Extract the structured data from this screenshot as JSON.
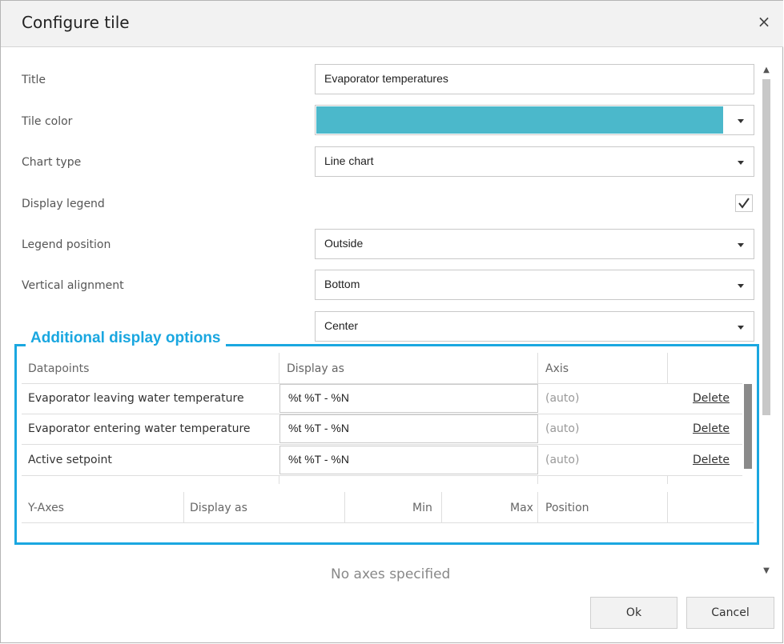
{
  "dialog": {
    "title": "Configure tile",
    "close_label": "×"
  },
  "form": {
    "title_label": "Title",
    "title_value": "Evaporator temperatures",
    "tile_color_label": "Tile color",
    "tile_color": "#4bb8cb",
    "chart_type_label": "Chart type",
    "chart_type_value": "Line chart",
    "display_legend_label": "Display legend",
    "display_legend_checked": true,
    "legend_position_label": "Legend position",
    "legend_position_value": "Outside",
    "vertical_alignment_label": "Vertical alignment",
    "vertical_alignment_value": "Bottom",
    "horizontal_alignment_value": "Center"
  },
  "annotation": {
    "title": "Additional display options",
    "color": "#1aa7e0"
  },
  "datapoints": {
    "headers": [
      "Datapoints",
      "Display as",
      "Axis"
    ],
    "rows": [
      {
        "name": "Evaporator leaving water temperature",
        "display_as": "%t %T - %N",
        "axis": "(auto)",
        "action": "Delete"
      },
      {
        "name": "Evaporator entering water temperature",
        "display_as": "%t %T - %N",
        "axis": "(auto)",
        "action": "Delete"
      },
      {
        "name": "Active setpoint",
        "display_as": "%t %T - %N",
        "axis": "(auto)",
        "action": "Delete"
      }
    ]
  },
  "yaxes": {
    "headers": [
      "Y-Axes",
      "Display as",
      "Min",
      "Max",
      "Position"
    ],
    "empty_text": "No axes specified"
  },
  "buttons": {
    "ok": "Ok",
    "cancel": "Cancel"
  },
  "icons": {
    "close": "close-icon",
    "check": "check-icon",
    "caret": "caret-down-icon"
  }
}
